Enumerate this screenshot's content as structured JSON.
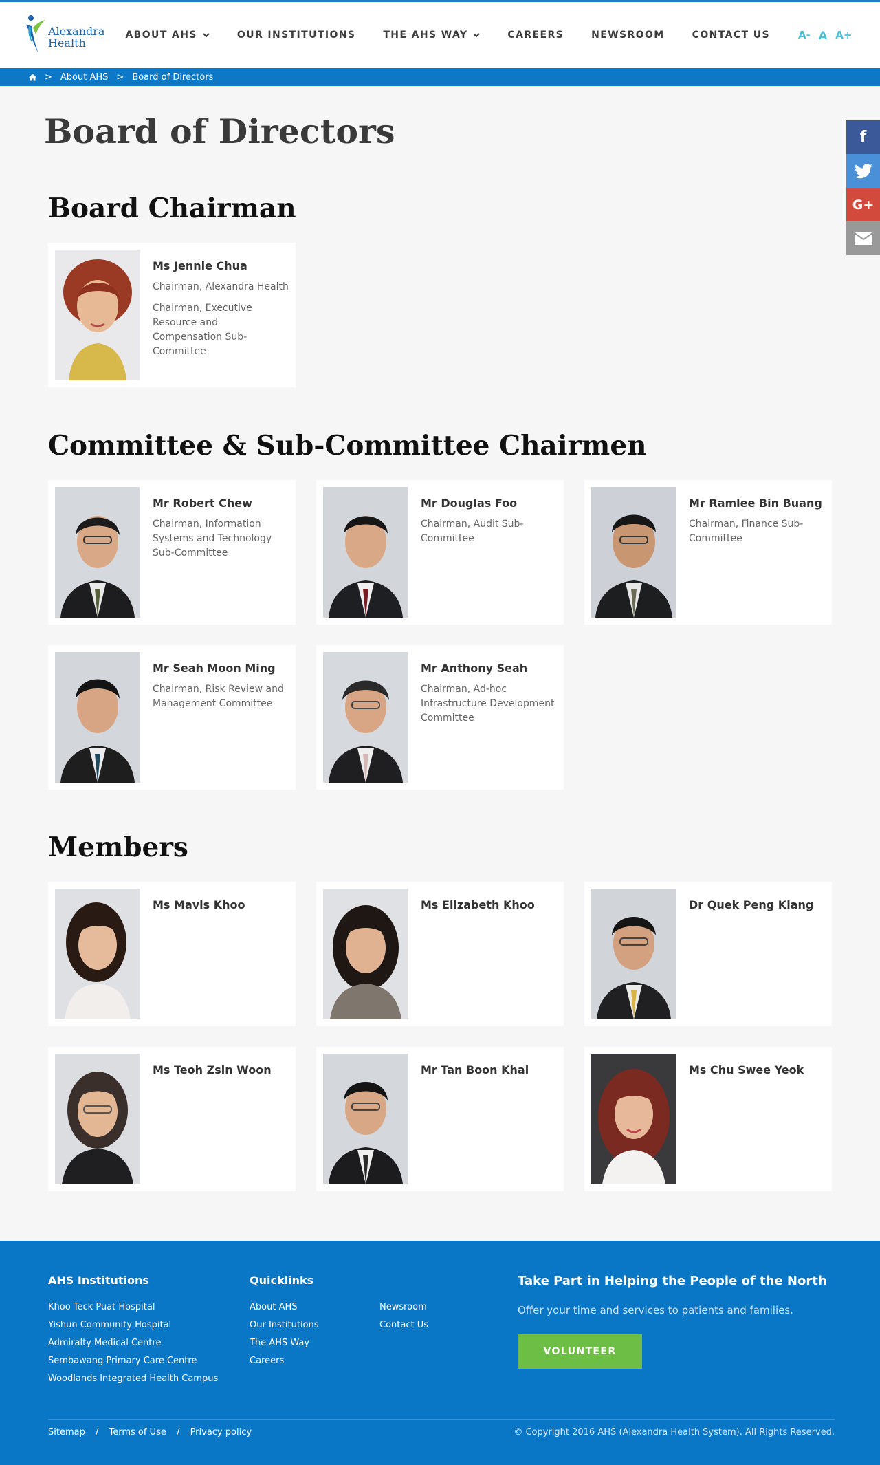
{
  "brand": {
    "name_line1": "Alexandra",
    "name_line2": "Health"
  },
  "nav": {
    "items": [
      {
        "label": "ABOUT AHS",
        "dropdown": true
      },
      {
        "label": "OUR INSTITUTIONS",
        "dropdown": false
      },
      {
        "label": "THE AHS WAY",
        "dropdown": true
      },
      {
        "label": "CAREERS",
        "dropdown": false
      },
      {
        "label": "NEWSROOM",
        "dropdown": false
      },
      {
        "label": "CONTACT US",
        "dropdown": false
      }
    ],
    "font_small": "A-",
    "font_normal": "A",
    "font_large": "A+",
    "search_icon": "search-icon"
  },
  "breadcrumb": {
    "home_icon": "home-icon",
    "separator": ">",
    "items": [
      "About AHS",
      "Board of Directors"
    ]
  },
  "social": {
    "facebook": "f",
    "twitter": "t",
    "googleplus": "G+",
    "email": "mail-icon"
  },
  "page": {
    "title": "Board of Directors"
  },
  "sections": {
    "chairman": {
      "title": "Board Chairman",
      "people": [
        {
          "name": "Ms Jennie Chua",
          "roles": [
            "Chairman, Alexandra Health",
            "Chairman, Executive Resource and Compensation Sub-Committee"
          ]
        }
      ]
    },
    "committee": {
      "title": "Committee & Sub-Committee Chairmen",
      "people": [
        {
          "name": "Mr Robert Chew",
          "roles": [
            "Chairman, Information Systems and Technology Sub-Committee"
          ]
        },
        {
          "name": "Mr Douglas Foo",
          "roles": [
            "Chairman, Audit Sub-Committee"
          ]
        },
        {
          "name": "Mr Ramlee Bin Buang",
          "roles": [
            "Chairman, Finance Sub-Committee"
          ]
        },
        {
          "name": "Mr Seah Moon Ming",
          "roles": [
            "Chairman, Risk Review and Management Committee"
          ]
        },
        {
          "name": "Mr Anthony Seah",
          "roles": [
            "Chairman, Ad-hoc Infrastructure Development Committee"
          ]
        }
      ]
    },
    "members": {
      "title": "Members",
      "people": [
        {
          "name": "Ms Mavis Khoo"
        },
        {
          "name": "Ms Elizabeth Khoo"
        },
        {
          "name": "Dr Quek Peng Kiang"
        },
        {
          "name": "Ms Teoh Zsin Woon"
        },
        {
          "name": "Mr Tan Boon Khai"
        },
        {
          "name": "Ms Chu Swee Yeok"
        }
      ]
    }
  },
  "footer": {
    "institutions_title": "AHS Institutions",
    "institutions": [
      "Khoo Teck Puat Hospital",
      "Yishun Community Hospital",
      "Admiralty Medical Centre",
      "Sembawang Primary Care Centre",
      "Woodlands Integrated Health Campus"
    ],
    "quicklinks_title": "Quicklinks",
    "quicklinks_a": [
      "About AHS",
      "Our Institutions",
      "The AHS Way",
      "Careers"
    ],
    "quicklinks_b": [
      "Newsroom",
      "Contact Us"
    ],
    "cta_title": "Take Part in Helping the People of the North",
    "cta_text": "Offer your time and services to patients and families.",
    "cta_button": "VOLUNTEER",
    "legal": [
      "Sitemap",
      "Terms of Use",
      "Privacy policy"
    ],
    "legal_separator": "/",
    "copyright": "© Copyright 2016 AHS (Alexandra Health System). All Rights Reserved."
  },
  "colors": {
    "brand_blue": "#0976c6",
    "breadcrumb_blue": "#0d78c6",
    "accent_cyan": "#4cc0d6",
    "volunteer_green": "#6cbf44",
    "facebook": "#3b5998",
    "twitter": "#4a90d9",
    "googleplus": "#d24a3b",
    "email": "#999999"
  }
}
